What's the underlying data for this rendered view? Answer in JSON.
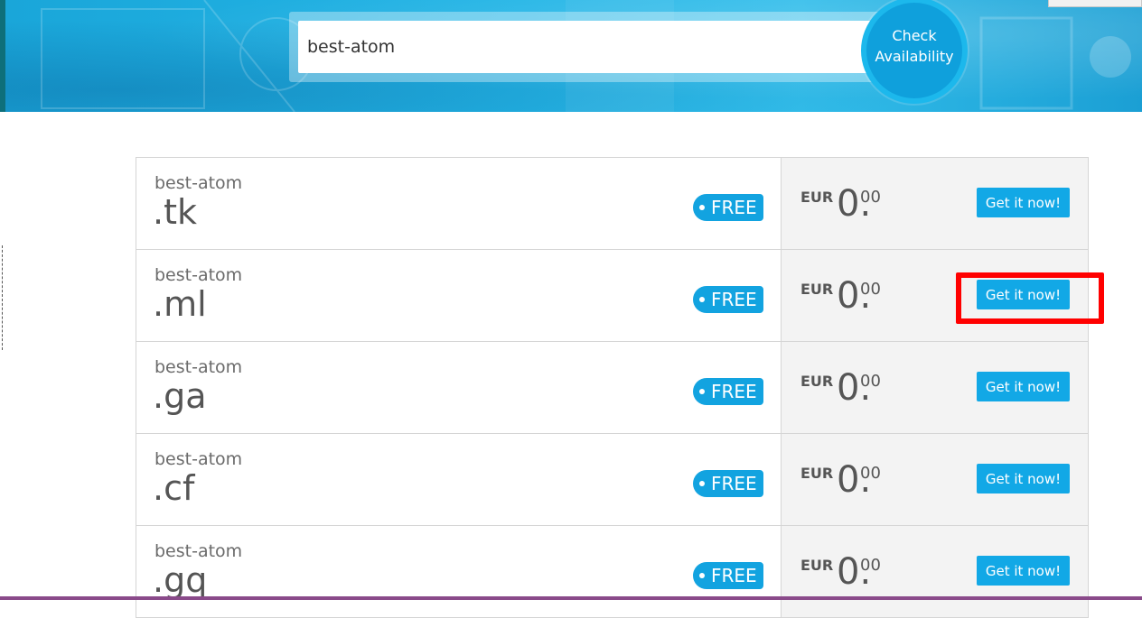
{
  "search": {
    "value": "best-atom",
    "button_line1": "Check",
    "button_line2": "Availability"
  },
  "results": [
    {
      "name": "best-atom",
      "tld": ".tk",
      "badge": "FREE",
      "currency": "EUR",
      "price_int": "0.",
      "price_dec": "00",
      "button": "Get it now!"
    },
    {
      "name": "best-atom",
      "tld": ".ml",
      "badge": "FREE",
      "currency": "EUR",
      "price_int": "0.",
      "price_dec": "00",
      "button": "Get it now!"
    },
    {
      "name": "best-atom",
      "tld": ".ga",
      "badge": "FREE",
      "currency": "EUR",
      "price_int": "0.",
      "price_dec": "00",
      "button": "Get it now!"
    },
    {
      "name": "best-atom",
      "tld": ".cf",
      "badge": "FREE",
      "currency": "EUR",
      "price_int": "0.",
      "price_dec": "00",
      "button": "Get it now!"
    },
    {
      "name": "best-atom",
      "tld": ".gq",
      "badge": "FREE",
      "currency": "EUR",
      "price_int": "0.",
      "price_dec": "00",
      "button": "Get it now!"
    }
  ],
  "colors": {
    "brand_blue": "#12a8e6",
    "highlight": "#ff0000"
  }
}
